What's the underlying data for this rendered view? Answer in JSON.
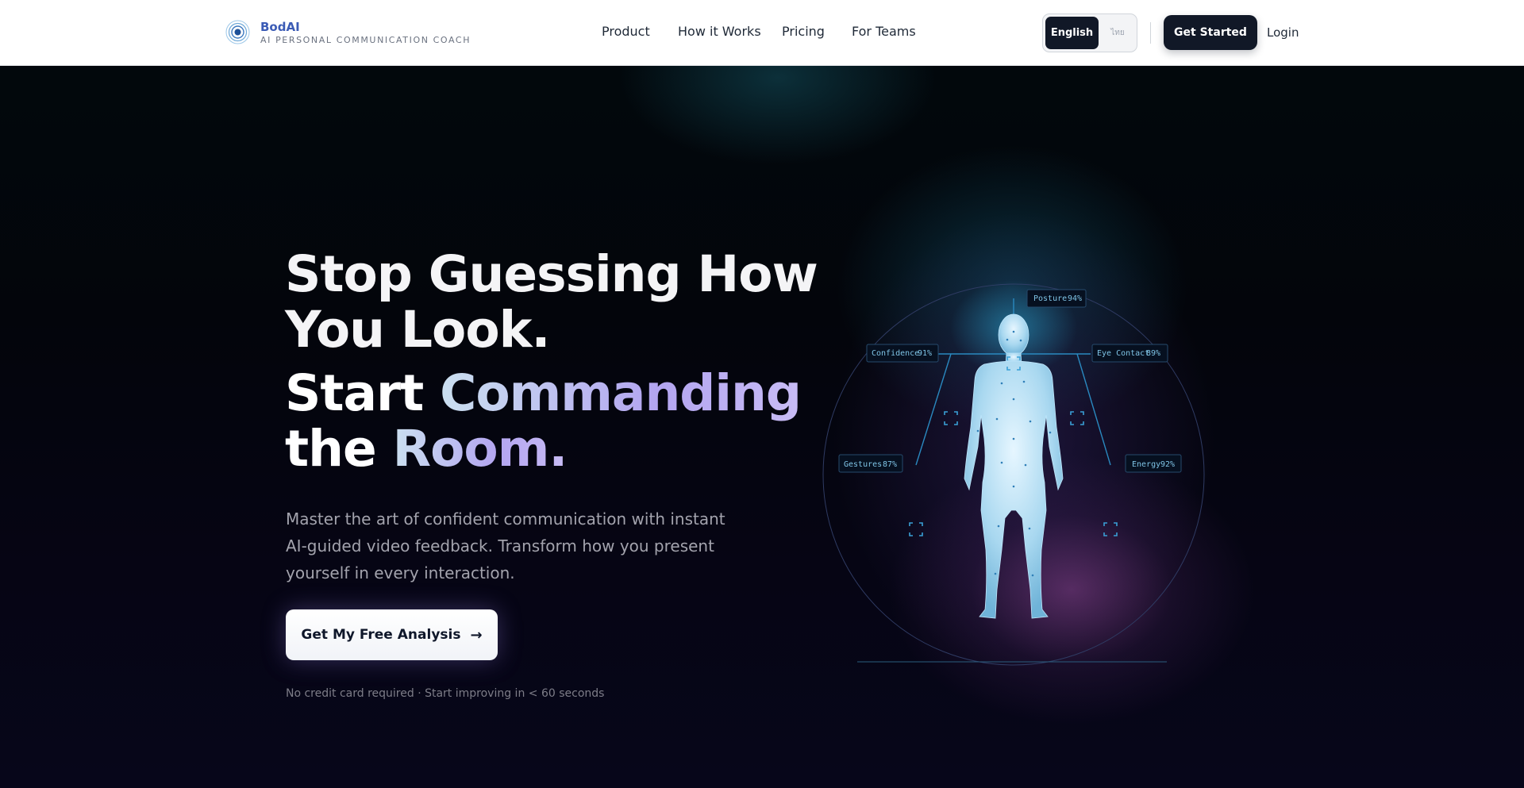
{
  "brand": {
    "name": "BodAI",
    "tagline": "AI PERSONAL COMMUNICATION COACH"
  },
  "nav": {
    "items": [
      "Product",
      "How it Works",
      "Pricing",
      "For Teams"
    ]
  },
  "language": {
    "selected": "English",
    "other": "ไทย"
  },
  "header_actions": {
    "get_started": "Get Started",
    "login": "Login"
  },
  "hero": {
    "headline_line1": "Stop Guessing How",
    "headline_line2": "You Look.",
    "headline_line3_start": "Start ",
    "headline_line3_highlight": "Commanding",
    "headline_line4_start": "the ",
    "headline_line4_highlight": "Room.",
    "subtitle": "Master the art of confident communication with instant AI-guided video feedback. Transform how you present yourself in every interaction.",
    "cta_label": "Get My Free Analysis",
    "note": "No credit card required · Start improving in < 60 seconds"
  },
  "metrics": [
    {
      "label": "Posture",
      "value": "94%"
    },
    {
      "label": "Confidence",
      "value": "91%"
    },
    {
      "label": "Eye Contact",
      "value": "89%"
    },
    {
      "label": "Gestures",
      "value": "87%"
    },
    {
      "label": "Energy",
      "value": "92%"
    }
  ],
  "colors": {
    "header_bg": "#ffffff",
    "brand_blue": "#3b5bb5",
    "dark_button": "#111827",
    "hero_bg": "#03050b",
    "accent_purple": "#b3a5f0",
    "scan_cyan": "#3aa0d6"
  }
}
